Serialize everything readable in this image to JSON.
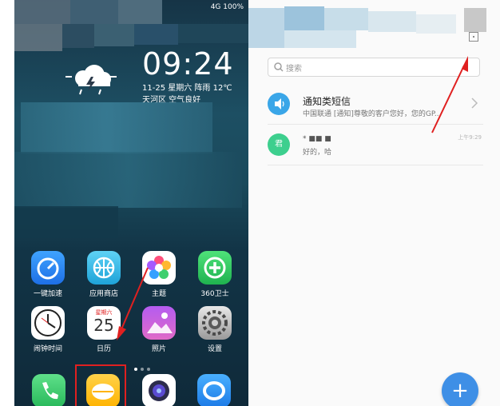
{
  "status_bar": {
    "text": "4G 100%"
  },
  "lock_widget": {
    "time": "09:24",
    "date_line": "11-25  星期六  阵雨  12℃",
    "location_line": "天河区  空气良好"
  },
  "home_apps": [
    {
      "label": "一键加速",
      "icon": "speedometer-icon"
    },
    {
      "label": "应用商店",
      "icon": "basketball-store-icon"
    },
    {
      "label": "主题",
      "icon": "theme-flower-icon"
    },
    {
      "label": "360卫士",
      "icon": "shield-plus-icon"
    },
    {
      "label": "闹钟时间",
      "icon": "clock-icon"
    },
    {
      "label": "日历",
      "icon": "calendar-icon",
      "sub": "星期六",
      "day": "25"
    },
    {
      "label": "照片",
      "icon": "photo-icon"
    },
    {
      "label": "设置",
      "icon": "settings-gear-icon"
    }
  ],
  "dock": [
    {
      "icon": "phone-icon"
    },
    {
      "icon": "messages-icon"
    },
    {
      "icon": "camera-icon"
    },
    {
      "icon": "browser-icon"
    }
  ],
  "messages": {
    "search_placeholder": "搜索",
    "items": [
      {
        "title": "通知类短信",
        "preview": "中国联通 [通知]尊敬的客户您好，您的GP...",
        "time": "",
        "avatar": "speaker-icon"
      },
      {
        "title": "*  ■■  ■",
        "preview": "好的，哈",
        "time": "上午9:29",
        "avatar_text": "君"
      }
    ],
    "fab_label": "+"
  },
  "colors": {
    "accent": "#3e8fe6",
    "avatar_green": "#3dcf8e",
    "highlight_red": "#e02020"
  }
}
